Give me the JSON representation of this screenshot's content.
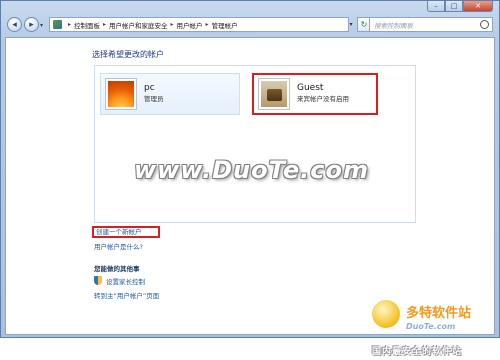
{
  "window": {
    "caption_buttons": {
      "minimize": "–",
      "maximize": "□",
      "close": "✕"
    }
  },
  "nav": {
    "back_icon": "back-arrow-icon",
    "forward_icon": "forward-arrow-icon",
    "breadcrumb": [
      "控制面板",
      "用户帐户和家庭安全",
      "用户帐户",
      "管理帐户"
    ],
    "search_placeholder": "搜索控制面板"
  },
  "main": {
    "heading": "选择希望更改的帐户",
    "accounts": [
      {
        "name": "pc",
        "type": "管理员",
        "avatar": "orange-flower-avatar",
        "highlighted": false
      },
      {
        "name": "Guest",
        "status": "来宾帐户没有启用",
        "avatar": "briefcase-avatar",
        "highlighted": true
      }
    ],
    "watermark": "www.DuoTe.com",
    "create_account_link": "创建一个新帐户",
    "what_is_account_link": "用户帐户是什么?",
    "also_see": {
      "title": "您能做的其他事",
      "parental_controls": "设置家长控制",
      "goto_user_accounts": "转到主“用户帐户”页面"
    }
  },
  "logo": {
    "name": "多特软件站",
    "site": "DuoTe.com",
    "slogan": "国内最安全的软件站"
  },
  "colors": {
    "highlight_border": "#d62020",
    "link": "#1c5aa8",
    "heading": "#1e3a8a"
  }
}
